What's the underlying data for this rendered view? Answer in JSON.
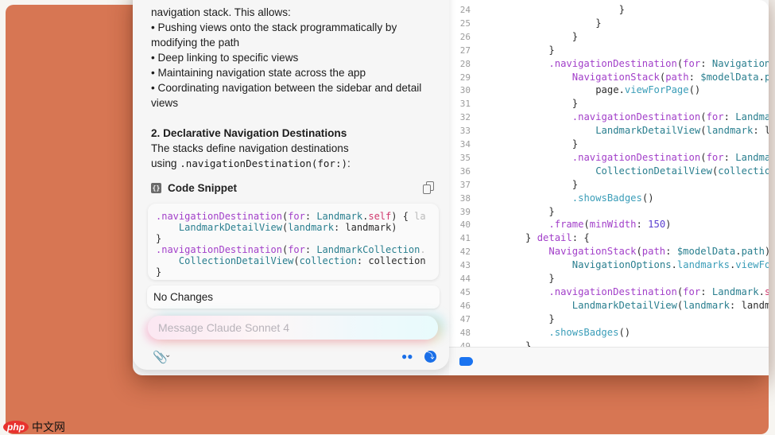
{
  "chat": {
    "message_lines": [
      "navigation stack. This allows:",
      "• Pushing views onto the stack programmatically by",
      "modifying the path",
      "• Deep linking to specific views",
      "• Maintaining navigation state across the app",
      "• Coordinating navigation between the sidebar and detail",
      "views"
    ],
    "heading": "2. Declarative Navigation Destinations",
    "para": "The stacks define navigation destinations",
    "para2_prefix": "using ",
    "para2_code": ".navigationDestination(for:)",
    "para2_suffix": ":",
    "snippet_title": "Code Snippet",
    "snippet_lines": [
      [
        [
          "m",
          ".navigationDestination"
        ],
        [
          "p",
          "("
        ],
        [
          "m",
          "for"
        ],
        [
          "p",
          ": "
        ],
        [
          "t",
          "Landmark"
        ],
        [
          "p",
          "."
        ],
        [
          "k",
          "self"
        ],
        [
          "p",
          ") { "
        ],
        [
          "g",
          "la"
        ]
      ],
      [
        [
          "p",
          "    "
        ],
        [
          "t",
          "LandmarkDetailView"
        ],
        [
          "p",
          "("
        ],
        [
          "t",
          "landmark"
        ],
        [
          "p",
          ": landmark)"
        ]
      ],
      [
        [
          "p",
          "}"
        ]
      ],
      [
        [
          "m",
          ".navigationDestination"
        ],
        [
          "p",
          "("
        ],
        [
          "m",
          "for"
        ],
        [
          "p",
          ": "
        ],
        [
          "t",
          "LandmarkCollection"
        ],
        [
          "g",
          "."
        ]
      ],
      [
        [
          "p",
          "    "
        ],
        [
          "t",
          "CollectionDetailView"
        ],
        [
          "p",
          "("
        ],
        [
          "t",
          "collection"
        ],
        [
          "p",
          ": collection"
        ]
      ],
      [
        [
          "p",
          "}"
        ]
      ]
    ],
    "status": "No Changes",
    "input_placeholder": "Message Claude Sonnet 4",
    "icons": [
      "paperclip-icon",
      "chevron-down-icon",
      "binoculars-icon",
      "bolt-icon"
    ]
  },
  "editor": {
    "lines": [
      {
        "n": "24",
        "i": 16,
        "tokens": [
          [
            "p",
            "}"
          ]
        ]
      },
      {
        "n": "25",
        "i": 12,
        "tokens": [
          [
            "p",
            "}"
          ]
        ]
      },
      {
        "n": "26",
        "i": 8,
        "tokens": [
          [
            "p",
            "}"
          ]
        ]
      },
      {
        "n": "27",
        "i": 4,
        "tokens": [
          [
            "p",
            "}"
          ]
        ]
      },
      {
        "n": "28",
        "i": 4,
        "tokens": [
          [
            "m",
            ".navigationDestination"
          ],
          [
            "p",
            "("
          ],
          [
            "m",
            "for"
          ],
          [
            "p",
            ": "
          ],
          [
            "t",
            "Navigation"
          ]
        ]
      },
      {
        "n": "29",
        "i": 8,
        "tokens": [
          [
            "m",
            "NavigationStack"
          ],
          [
            "p",
            "("
          ],
          [
            "m",
            "path"
          ],
          [
            "p",
            ": "
          ],
          [
            "t",
            "$modelData"
          ],
          [
            "p",
            "."
          ],
          [
            "t",
            "p"
          ]
        ]
      },
      {
        "n": "30",
        "i": 12,
        "tokens": [
          [
            "p",
            "page."
          ],
          [
            "f",
            "viewForPage"
          ],
          [
            "p",
            "()"
          ]
        ]
      },
      {
        "n": "31",
        "i": 8,
        "tokens": [
          [
            "p",
            "}"
          ]
        ]
      },
      {
        "n": "32",
        "i": 8,
        "tokens": [
          [
            "m",
            ".navigationDestination"
          ],
          [
            "p",
            "("
          ],
          [
            "m",
            "for"
          ],
          [
            "p",
            ": "
          ],
          [
            "t",
            "Landma"
          ]
        ]
      },
      {
        "n": "33",
        "i": 12,
        "tokens": [
          [
            "t",
            "LandmarkDetailView"
          ],
          [
            "p",
            "("
          ],
          [
            "t",
            "landmark"
          ],
          [
            "p",
            ": l"
          ]
        ]
      },
      {
        "n": "34",
        "i": 8,
        "tokens": [
          [
            "p",
            "}"
          ]
        ]
      },
      {
        "n": "35",
        "i": 8,
        "tokens": [
          [
            "m",
            ".navigationDestination"
          ],
          [
            "p",
            "("
          ],
          [
            "m",
            "for"
          ],
          [
            "p",
            ": "
          ],
          [
            "t",
            "Landma"
          ]
        ]
      },
      {
        "n": "36",
        "i": 12,
        "tokens": [
          [
            "t",
            "CollectionDetailView"
          ],
          [
            "p",
            "("
          ],
          [
            "t",
            "collectio"
          ]
        ]
      },
      {
        "n": "37",
        "i": 8,
        "tokens": [
          [
            "p",
            "}"
          ]
        ]
      },
      {
        "n": "38",
        "i": 8,
        "tokens": [
          [
            "f",
            ".showsBadges"
          ],
          [
            "p",
            "()"
          ]
        ]
      },
      {
        "n": "39",
        "i": 4,
        "tokens": [
          [
            "p",
            "}"
          ]
        ]
      },
      {
        "n": "40",
        "i": 4,
        "tokens": [
          [
            "m",
            ".frame"
          ],
          [
            "p",
            "("
          ],
          [
            "m",
            "minWidth"
          ],
          [
            "p",
            ": "
          ],
          [
            "n",
            "150"
          ],
          [
            "p",
            ")"
          ]
        ]
      },
      {
        "n": "41",
        "i": 0,
        "tokens": [
          [
            "p",
            "} "
          ],
          [
            "m",
            "detail"
          ],
          [
            "p",
            ": {"
          ]
        ]
      },
      {
        "n": "42",
        "i": 4,
        "tokens": [
          [
            "m",
            "NavigationStack"
          ],
          [
            "p",
            "("
          ],
          [
            "m",
            "path"
          ],
          [
            "p",
            ": "
          ],
          [
            "t",
            "$modelData"
          ],
          [
            "p",
            "."
          ],
          [
            "t",
            "path"
          ],
          [
            "p",
            ")"
          ]
        ]
      },
      {
        "n": "43",
        "i": 8,
        "tokens": [
          [
            "t",
            "NavigationOptions"
          ],
          [
            "p",
            "."
          ],
          [
            "f",
            "landmarks"
          ],
          [
            "p",
            "."
          ],
          [
            "f",
            "viewFo"
          ]
        ]
      },
      {
        "n": "44",
        "i": 4,
        "tokens": [
          [
            "p",
            "}"
          ]
        ]
      },
      {
        "n": "45",
        "i": 4,
        "tokens": [
          [
            "m",
            ".navigationDestination"
          ],
          [
            "p",
            "("
          ],
          [
            "m",
            "for"
          ],
          [
            "p",
            ": "
          ],
          [
            "t",
            "Landmark"
          ],
          [
            "p",
            "."
          ],
          [
            "k",
            "s"
          ]
        ]
      },
      {
        "n": "46",
        "i": 8,
        "tokens": [
          [
            "t",
            "LandmarkDetailView"
          ],
          [
            "p",
            "("
          ],
          [
            "t",
            "landmark"
          ],
          [
            "p",
            ": landm"
          ]
        ]
      },
      {
        "n": "47",
        "i": 4,
        "tokens": [
          [
            "p",
            "}"
          ]
        ]
      },
      {
        "n": "48",
        "i": 4,
        "tokens": [
          [
            "f",
            ".showsBadges"
          ],
          [
            "p",
            "()"
          ]
        ]
      },
      {
        "n": "49",
        "i": 0,
        "tokens": [
          [
            "p",
            "}"
          ]
        ]
      }
    ]
  },
  "colors": {
    "background": "#d77653",
    "accent": "#1a6fe8"
  },
  "watermark": {
    "logo": "php",
    "text": "中文网"
  }
}
